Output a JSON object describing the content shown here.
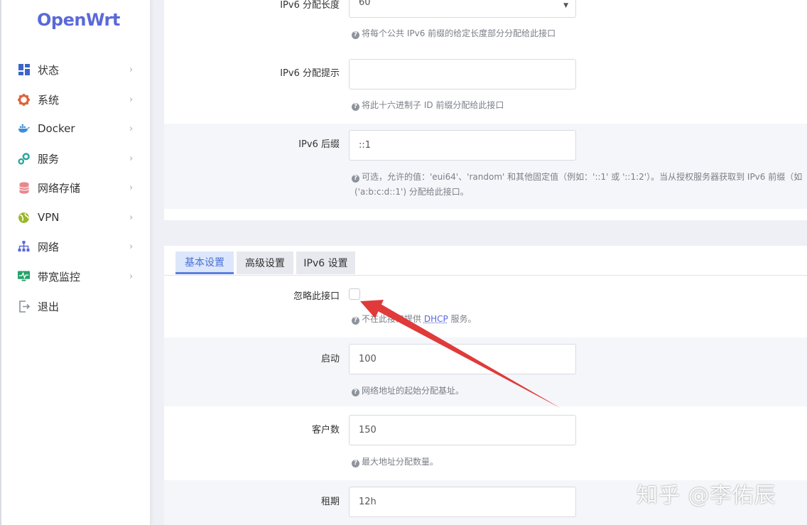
{
  "app": {
    "logo": "OpenWrt"
  },
  "sidebar": {
    "items": [
      {
        "label": "状态",
        "icon": "dashboard-icon"
      },
      {
        "label": "系统",
        "icon": "gear-icon"
      },
      {
        "label": "Docker",
        "icon": "docker-icon"
      },
      {
        "label": "服务",
        "icon": "services-icon"
      },
      {
        "label": "网络存储",
        "icon": "storage-icon"
      },
      {
        "label": "VPN",
        "icon": "vpn-icon"
      },
      {
        "label": "网络",
        "icon": "network-icon"
      },
      {
        "label": "带宽监控",
        "icon": "monitor-icon"
      },
      {
        "label": "退出",
        "icon": "logout-icon"
      }
    ],
    "chevron": "›"
  },
  "ipv6": {
    "assign_length": {
      "label": "IPv6 分配长度",
      "value": "60",
      "hint": "将每个公共 IPv6 前缀的给定长度部分分配给此接口"
    },
    "assign_hint": {
      "label": "IPv6 分配提示",
      "value": "",
      "hint": "将此十六进制子 ID 前缀分配给此接口"
    },
    "suffix": {
      "label": "IPv6 后缀",
      "value": "::1",
      "hint_line1": "可选，允许的值：'eui64'、'random' 和其他固定值（例如：'::1' 或 '::1:2'）。当从授权服务器获取到 IPv6 前缀（如",
      "hint_line2": "('a:b:c:d::1') 分配给此接口。"
    }
  },
  "tabs": [
    "基本设置",
    "高级设置",
    "IPv6 设置"
  ],
  "dhcp": {
    "ignore": {
      "label": "忽略此接口",
      "checked": false,
      "hint_pre": "不在此接口提供 ",
      "hint_link": "DHCP",
      "hint_post": " 服务。"
    },
    "start": {
      "label": "启动",
      "value": "100",
      "hint": "网络地址的起始分配基址。"
    },
    "limit": {
      "label": "客户数",
      "value": "150",
      "hint": "最大地址分配数量。"
    },
    "lease": {
      "label": "租期",
      "value": "12h"
    }
  },
  "watermark": "知乎 @李佑辰",
  "colors": {
    "accent": "#5a69d8",
    "annotation_arrow": "#e03a3a"
  }
}
